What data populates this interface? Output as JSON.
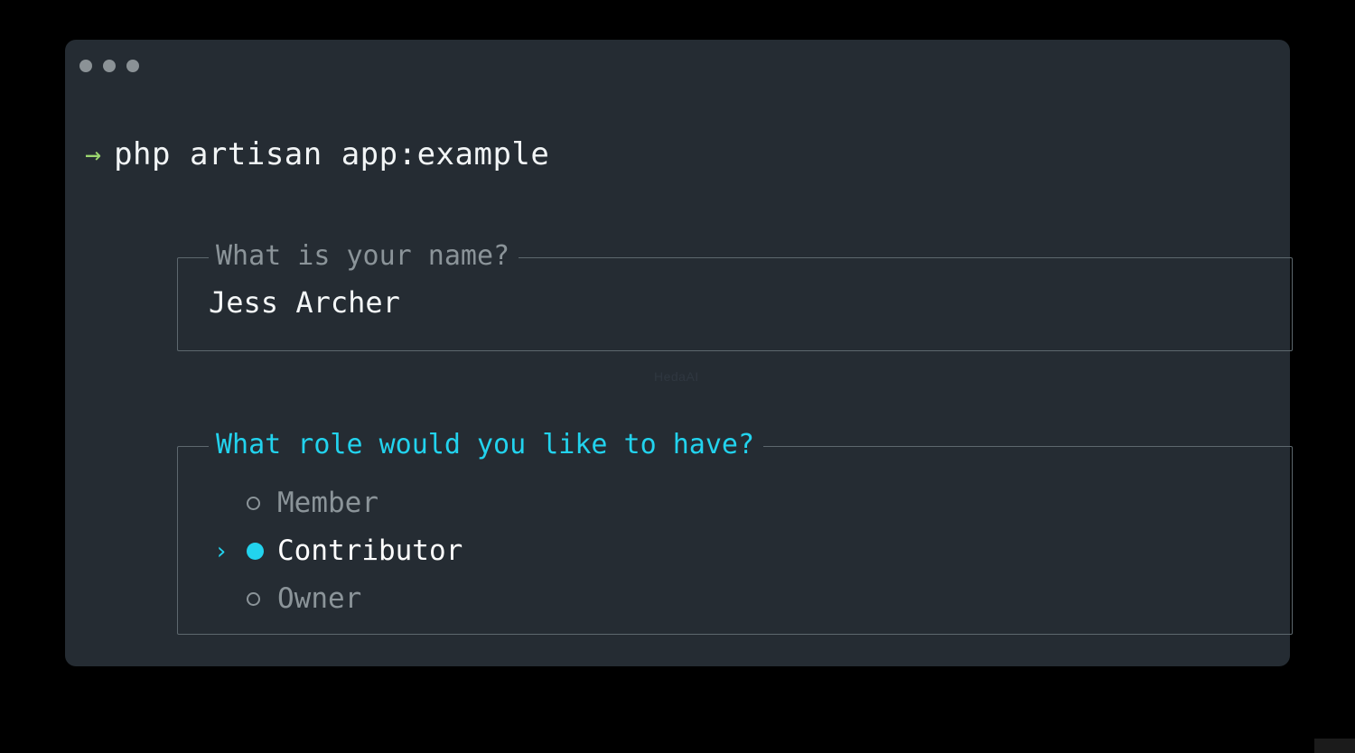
{
  "window": {
    "background_color": "#252c33",
    "page_background_color": "#000000",
    "traffic_lights": [
      "close-dot",
      "minimize-dot",
      "maximize-dot"
    ],
    "traffic_light_color": "#8b9296"
  },
  "command_line": {
    "prompt_glyph": "→",
    "prompt_color": "#9bd66e",
    "command": "php artisan app:example",
    "command_color": "#f2f5f6"
  },
  "prompts": [
    {
      "name": "name-question",
      "label": "What is your name?",
      "label_color": "#8b9499",
      "state": "answered",
      "answer": "Jess Archer",
      "answer_color": "#f4f7f8"
    },
    {
      "name": "role-question",
      "label": "What role would you like to have?",
      "label_color": "#22d3ee",
      "state": "active",
      "pointer_glyph": "›",
      "accent_color": "#22d3ee",
      "options": [
        {
          "label": "Member",
          "selected": false,
          "marker": "radio-hollow-icon"
        },
        {
          "label": "Contributor",
          "selected": true,
          "marker": "radio-filled-icon"
        },
        {
          "label": "Owner",
          "selected": false,
          "marker": "radio-hollow-icon"
        }
      ]
    }
  ],
  "watermark": {
    "text": "HedaAI",
    "color": "#2f3740"
  }
}
